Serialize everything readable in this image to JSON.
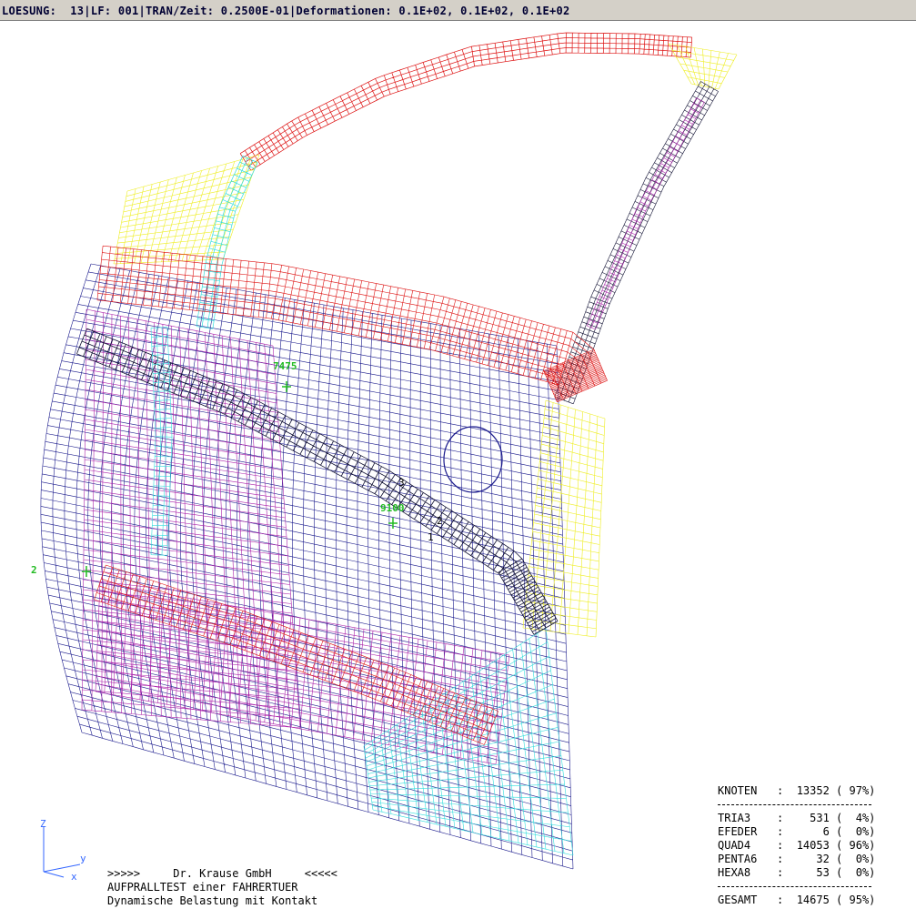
{
  "header": {
    "text": "LOESUNG:  13|LF: 001|TRAN/Zeit: 0.2500E-01|Deformationen: 0.1E+02, 0.1E+02, 0.1E+02"
  },
  "node_labels": {
    "n1": "7475",
    "n2": "9100",
    "n3": "2"
  },
  "markers": {
    "m3": "3",
    "m2": "2",
    "m1": "1"
  },
  "axes": {
    "z": "Z",
    "y": "y",
    "x": "x"
  },
  "footer": {
    "line1": ">>>>>     Dr. Krause GmbH     <<<<<",
    "line2": "AUFPRALLTEST einer FAHRERTUER",
    "line3": "Dynamische Belastung mit Kontakt"
  },
  "stats": {
    "knoten": "KNOTEN   :  13352 ( 97%)",
    "tria3": "TRIA3    :    531 (  4%)",
    "efeder": "EFEDER   :      6 (  0%)",
    "quad4": "QUAD4    :  14053 ( 96%)",
    "penta6": "PENTA6   :     32 (  0%)",
    "hexa8": "HEXA8    :     53 (  0%)",
    "gesamt": "GESAMT   :  14675 ( 95%)"
  },
  "colors": {
    "panel_mesh": "#1a1a8c",
    "frame_red": "#dd1111",
    "magenta": "#aa22aa",
    "yellow": "#eeee22",
    "cyan": "#33dddd",
    "beam_dark": "#111133",
    "label_green": "#22bb22",
    "axis_blue": "#3366ff"
  }
}
